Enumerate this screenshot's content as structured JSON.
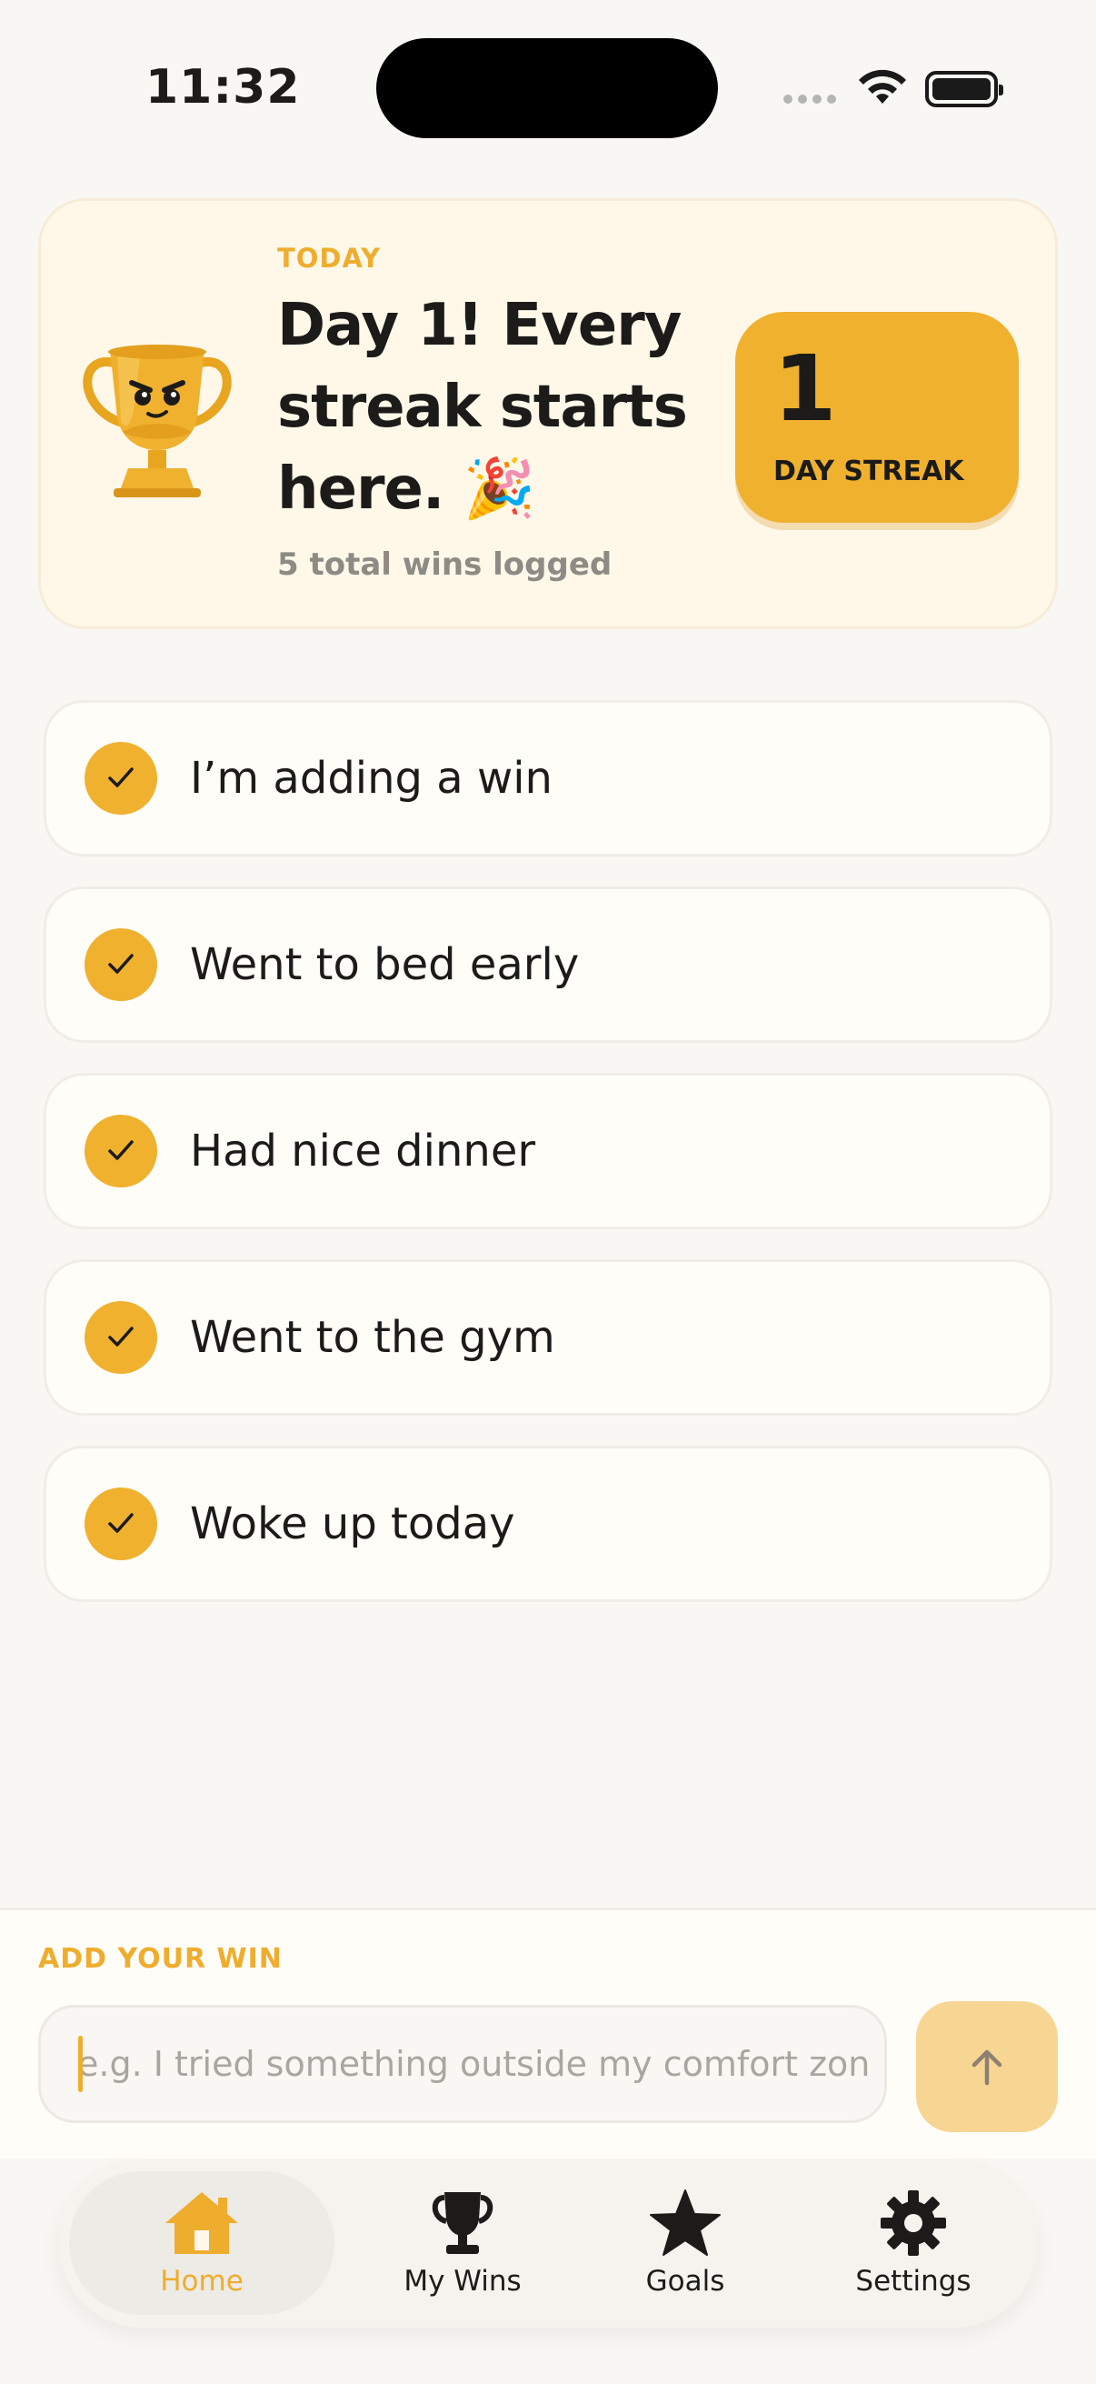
{
  "status_bar": {
    "time": "11:32"
  },
  "streak_card": {
    "section_label": "TODAY",
    "message": "Day 1! Every streak starts here. 🎉",
    "total_wins_text": "5 total wins logged",
    "day_count": "1",
    "day_label": "DAY STREAK",
    "icons": {
      "illustration": "trophy-mascot-icon",
      "emoji": "party-popper"
    }
  },
  "wins": [
    {
      "text": "I’m adding a win",
      "done": true
    },
    {
      "text": "Went to bed early",
      "done": true
    },
    {
      "text": "Had nice dinner",
      "done": true
    },
    {
      "text": "Went to the gym",
      "done": true
    },
    {
      "text": "Woke up today",
      "done": true
    }
  ],
  "add_win": {
    "label": "ADD YOUR WIN",
    "placeholder": "e.g. I tried something outside my comfort zon",
    "value": "",
    "submit_icon": "arrow-up-icon"
  },
  "tab_bar": {
    "active": "Home",
    "tabs": [
      {
        "label": "Home",
        "icon": "home-icon"
      },
      {
        "label": "My Wins",
        "icon": "trophy-icon"
      },
      {
        "label": "Goals",
        "icon": "star-icon"
      },
      {
        "label": "Settings",
        "icon": "gear-icon"
      }
    ]
  },
  "colors": {
    "accent": "#f0b12f",
    "accent_light": "#f7d592",
    "card_background": "#fff8e9",
    "page_background": "#f8f7f3"
  }
}
